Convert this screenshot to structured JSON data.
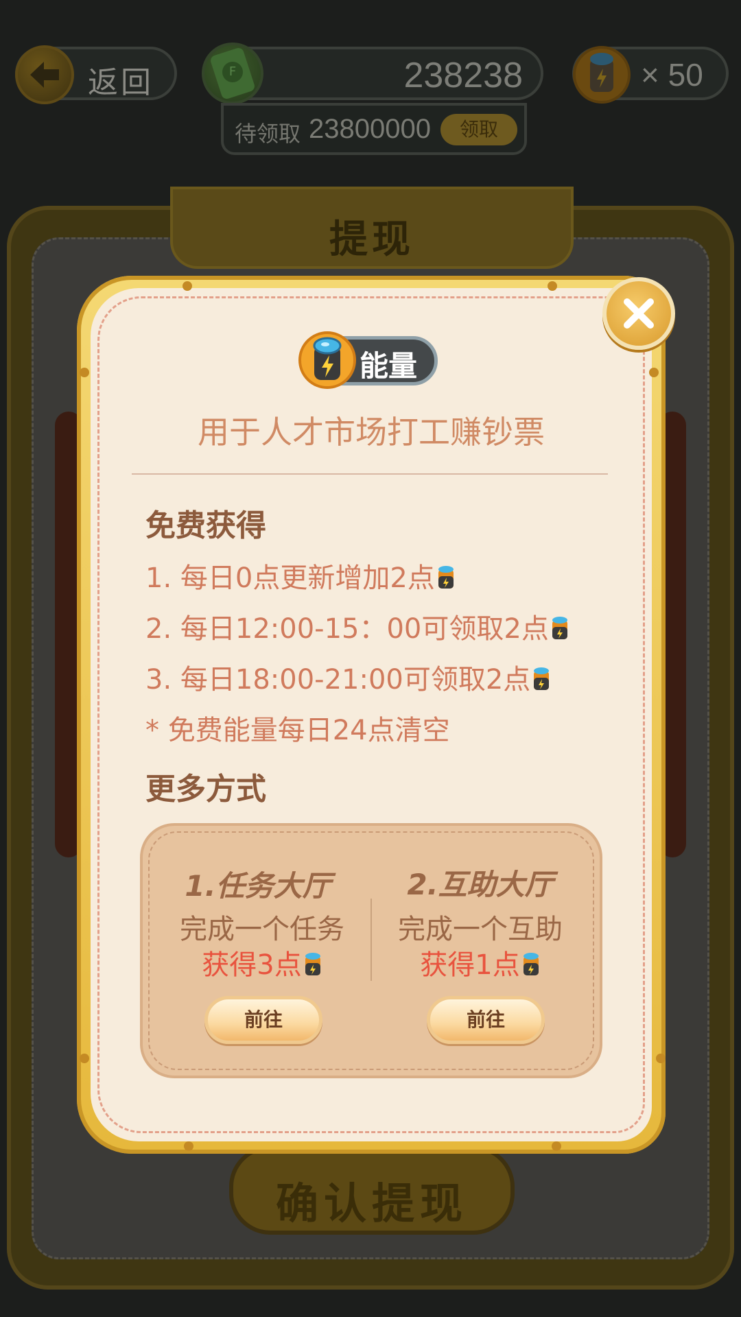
{
  "hud": {
    "back_label": "返回",
    "money_value": "238238",
    "pending_label": "待领取",
    "pending_value": "23800000",
    "claim_label": "领取",
    "energy_count": "× 50"
  },
  "background": {
    "title": "提现",
    "confirm_label": "确认提现"
  },
  "modal": {
    "tag_label": "能量",
    "subtitle": "用于人才市场打工赚钞票",
    "free_title": "免费获得",
    "free_rules": [
      "1. 每日0点更新增加2点",
      "2. 每日12:00-15：00可领取2点",
      "3. 每日18:00-21:00可领取2点"
    ],
    "free_note": "* 免费能量每日24点清空",
    "more_title": "更多方式",
    "ways": [
      {
        "title": "1.任务大厅",
        "desc": "完成一个任务",
        "reward": "获得3点",
        "button": "前往"
      },
      {
        "title": "2.互助大厅",
        "desc": "完成一个互助",
        "reward": "获得1点",
        "button": "前往"
      }
    ]
  },
  "colors": {
    "gold_frame": "#e6b83c",
    "modal_bg": "#f7ecdc",
    "accent_text": "#d07a5c",
    "reward_red": "#e8533e"
  },
  "icons": [
    "back-arrow-icon",
    "money-icon",
    "energy-battery-icon",
    "close-icon"
  ]
}
